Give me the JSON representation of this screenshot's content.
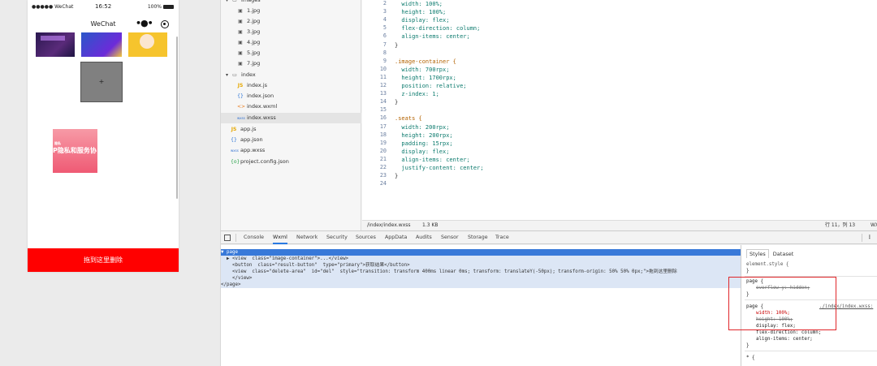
{
  "simulator": {
    "carrier": "●●●●● WeChat",
    "time": "16:52",
    "battery": "100%",
    "nav_title": "WeChat",
    "capsule_more": "•●•",
    "add_tile": "+",
    "card_small": "隐私",
    "card_big": "P隐私和服务协",
    "delete_label": "拖到这里删除"
  },
  "file_tree": [
    {
      "label": "images",
      "icon": "folder-icon"
    },
    {
      "label": "1.jpg",
      "icon": "image-icon"
    },
    {
      "label": "2.jpg",
      "icon": "image-icon"
    },
    {
      "label": "3.jpg",
      "icon": "image-icon"
    },
    {
      "label": "4.jpg",
      "icon": "image-icon"
    },
    {
      "label": "5.jpg",
      "icon": "image-icon"
    },
    {
      "label": "7.jpg",
      "icon": "image-icon"
    },
    {
      "label": "index",
      "icon": "folder-icon"
    },
    {
      "label": "index.js",
      "icon": "js-icon"
    },
    {
      "label": "index.json",
      "icon": "json-icon"
    },
    {
      "label": "index.wxml",
      "icon": "wxml-icon"
    },
    {
      "label": "index.wxss",
      "icon": "wxss-icon"
    },
    {
      "label": "app.js",
      "icon": "js-icon"
    },
    {
      "label": "app.json",
      "icon": "json-icon"
    },
    {
      "label": "app.wxss",
      "icon": "wxss-icon"
    },
    {
      "label": "project.config.json",
      "icon": "config-icon"
    }
  ],
  "editor": {
    "lines": [
      {
        "n": "2",
        "code": "  width: 100%;"
      },
      {
        "n": "3",
        "code": "  height: 100%;"
      },
      {
        "n": "4",
        "code": "  display: flex;"
      },
      {
        "n": "5",
        "code": "  flex-direction: column;"
      },
      {
        "n": "6",
        "code": "  align-items: center;"
      },
      {
        "n": "7",
        "code": "}"
      },
      {
        "n": "8",
        "code": ""
      },
      {
        "n": "9",
        "code": ".image-container {"
      },
      {
        "n": "10",
        "code": "  width: 700rpx;"
      },
      {
        "n": "11",
        "code": "  height: 1700rpx;"
      },
      {
        "n": "12",
        "code": "  position: relative;"
      },
      {
        "n": "13",
        "code": "  z-index: 1;"
      },
      {
        "n": "14",
        "code": "}"
      },
      {
        "n": "15",
        "code": ""
      },
      {
        "n": "16",
        "code": ".seats {"
      },
      {
        "n": "17",
        "code": "  width: 200rpx;"
      },
      {
        "n": "18",
        "code": "  height: 200rpx;"
      },
      {
        "n": "19",
        "code": "  padding: 15rpx;"
      },
      {
        "n": "20",
        "code": "  display: flex;"
      },
      {
        "n": "21",
        "code": "  align-items: center;"
      },
      {
        "n": "22",
        "code": "  justify-content: center;"
      },
      {
        "n": "23",
        "code": "}"
      },
      {
        "n": "24",
        "code": ""
      }
    ],
    "status_path": "/index/index.wxss",
    "status_size": "1.3 KB",
    "status_pos": "行 11，列 13",
    "status_lang": "WX"
  },
  "devtools": {
    "tabs": [
      "Console",
      "Wxml",
      "Network",
      "Security",
      "Sources",
      "AppData",
      "Audits",
      "Sensor",
      "Storage",
      "Trace"
    ],
    "active_tab": "Wxml",
    "wxml_lines": [
      "▼ page",
      "  ▶ <view  class=\"image-container\">...</view>",
      "    <button  class=\"result-button\"  type=\"primary\">获取结果</button>",
      "    <view  class=\"delete-area\"  id=\"del\"  style=\"transition: transform 400ms linear 0ms; transform: translateY(-50px); transform-origin: 50% 50% 0px;\">拖到这里删除",
      "    </view>",
      "</page>"
    ],
    "styles_tabs": [
      "Styles",
      "Dataset"
    ],
    "styles": {
      "element_style": "element.style {",
      "close": "}",
      "page_rule1": "page {",
      "overflow": "overflow-y: hidden;",
      "page_rule2": "page {",
      "source_link": "./index/index.wxss:",
      "width": "width: 100%;",
      "height": "height: 100%;",
      "display": "display: flex;",
      "flex_dir": "flex-direction: column;",
      "align": "align-items: center;",
      "star": "* {"
    }
  }
}
